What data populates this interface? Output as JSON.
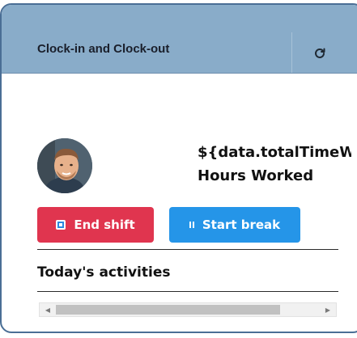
{
  "header": {
    "title": "Clock-in and Clock-out",
    "refresh_icon": "refresh-icon"
  },
  "profile": {
    "avatar_icon": "avatar"
  },
  "time": {
    "total_time": "${data.totalTimeW",
    "hours_label": "Hours Worked"
  },
  "actions": {
    "end_shift_label": "End shift",
    "end_shift_color": "#e0354f",
    "start_break_label": "Start break",
    "start_break_color": "#2595e8"
  },
  "activities": {
    "title": "Today's activities"
  },
  "scrollbar": {
    "left_arrow": "◀",
    "right_arrow": "▶"
  }
}
